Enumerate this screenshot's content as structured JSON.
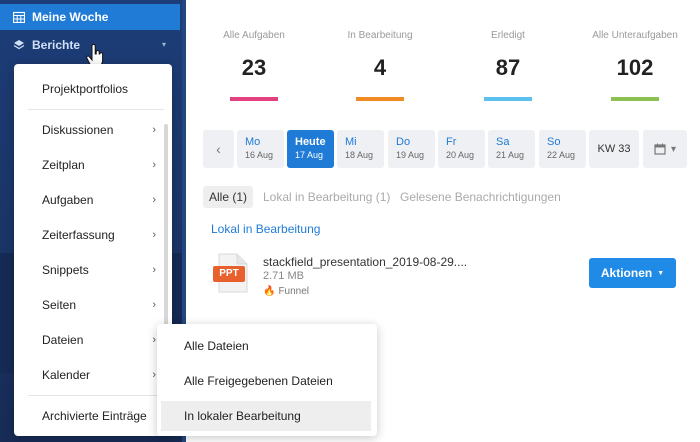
{
  "sidebar": {
    "active_item": "Meine Woche",
    "berichte_item": "Berichte"
  },
  "menu": {
    "items": [
      {
        "label": "Projektportfolios",
        "has_submenu": false
      },
      {
        "label": "Diskussionen",
        "has_submenu": true
      },
      {
        "label": "Zeitplan",
        "has_submenu": true
      },
      {
        "label": "Aufgaben",
        "has_submenu": true
      },
      {
        "label": "Zeiterfassung",
        "has_submenu": true
      },
      {
        "label": "Snippets",
        "has_submenu": true
      },
      {
        "label": "Seiten",
        "has_submenu": true
      },
      {
        "label": "Dateien",
        "has_submenu": true
      },
      {
        "label": "Kalender",
        "has_submenu": true
      },
      {
        "label": "Archivierte Einträge",
        "has_submenu": false
      }
    ],
    "arrow_glyph": "›"
  },
  "submenu": {
    "items": [
      {
        "label": "Alle Dateien"
      },
      {
        "label": "Alle Freigegebenen Dateien"
      },
      {
        "label": "In lokaler Bearbeitung"
      }
    ]
  },
  "stats": [
    {
      "label": "Alle Aufgaben",
      "value": "23",
      "color": "#e2407f"
    },
    {
      "label": "In Bearbeitung",
      "value": "4",
      "color": "#f08a24"
    },
    {
      "label": "Erledigt",
      "value": "87",
      "color": "#5bc0eb"
    },
    {
      "label": "Alle Unteraufgaben",
      "value": "102",
      "color": "#8cc152"
    }
  ],
  "week": {
    "prev_glyph": "‹",
    "days": [
      {
        "name": "Mo",
        "date": "16 Aug",
        "today": false
      },
      {
        "name": "Heute",
        "date": "17 Aug",
        "today": true
      },
      {
        "name": "Mi",
        "date": "18 Aug",
        "today": false
      },
      {
        "name": "Do",
        "date": "19 Aug",
        "today": false
      },
      {
        "name": "Fr",
        "date": "20 Aug",
        "today": false
      },
      {
        "name": "Sa",
        "date": "21 Aug",
        "today": false
      },
      {
        "name": "So",
        "date": "22 Aug",
        "today": false
      }
    ],
    "week_label": "KW 33",
    "calendar_icon": "calendar-icon"
  },
  "tabs": [
    {
      "label": "Alle (1)",
      "active": true
    },
    {
      "label": "Lokal in Bearbeitung (1)",
      "active": false
    },
    {
      "label": "Gelesene Benachrichtigungen",
      "active": false
    }
  ],
  "section_title": "Lokal in Bearbeitung",
  "file": {
    "type_label": "PPT",
    "name": "stackfield_presentation_2019-08-29....",
    "size": "2.71 MB",
    "tag": "Funnel",
    "actions_label": "Aktionen"
  },
  "colors": {
    "accent": "#1f7bd6",
    "sidebar": "#1a3566",
    "ppt": "#e8602c"
  }
}
